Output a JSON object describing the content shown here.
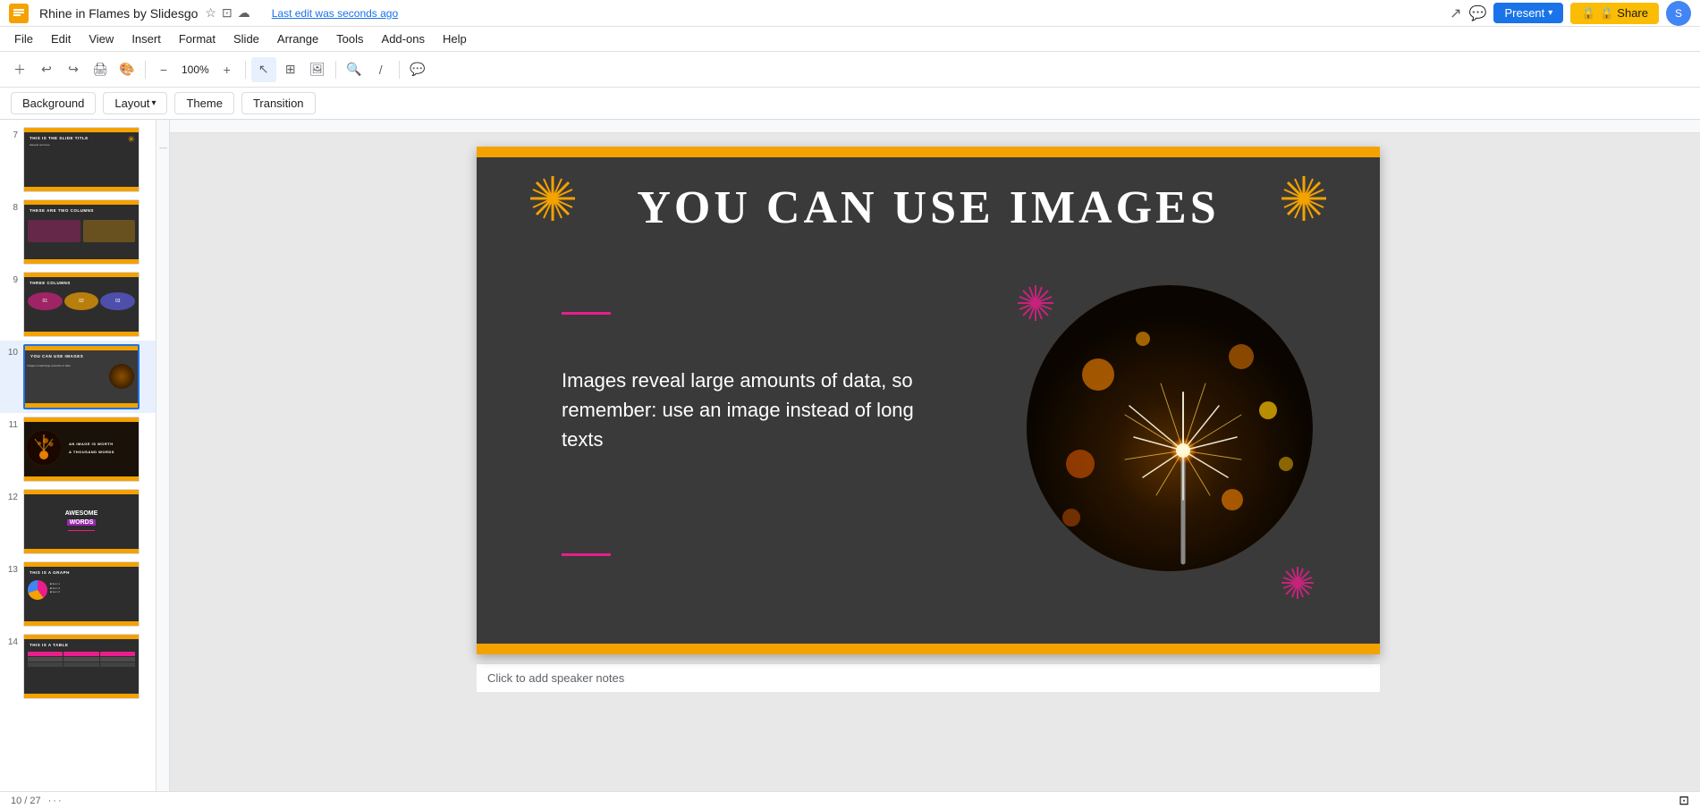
{
  "app": {
    "title": "Rhine in Flames by Slidesgo",
    "icon": "🟡",
    "edit_status": "Last edit was seconds ago"
  },
  "header": {
    "present_label": "Present",
    "share_label": "🔒 Share",
    "avatar_text": "S"
  },
  "menu": {
    "items": [
      "File",
      "Edit",
      "View",
      "Insert",
      "Format",
      "Slide",
      "Arrange",
      "Tools",
      "Add-ons",
      "Help"
    ]
  },
  "format_toolbar": {
    "background_label": "Background",
    "layout_label": "Layout",
    "theme_label": "Theme",
    "transition_label": "Transition"
  },
  "slides": [
    {
      "num": "7",
      "title": "THIS IS THE SLIDE TITLE",
      "type": "title"
    },
    {
      "num": "8",
      "title": "THESE ARE TWO COLUMNS",
      "type": "two-col"
    },
    {
      "num": "9",
      "title": "THREE COLUMNS",
      "type": "three-col"
    },
    {
      "num": "10",
      "title": "YOU CAN USE IMAGES",
      "type": "image",
      "active": true
    },
    {
      "num": "11",
      "title": "AN IMAGE IS WORTH A THOUSAND WORDS",
      "type": "sparkler"
    },
    {
      "num": "12",
      "title": "AWESOME WORDS",
      "type": "words"
    },
    {
      "num": "13",
      "title": "THIS IS A GRAPH",
      "type": "graph"
    },
    {
      "num": "14",
      "title": "THIS IS A TABLE",
      "type": "table"
    }
  ],
  "current_slide": {
    "title": "YOU CAN USE IMAGES",
    "body_text": "Images reveal large amounts of data, so remember: use an image instead of long texts",
    "decorations": {
      "star_left": "✳",
      "star_right": "✳",
      "starburst_color": "#e91e8c",
      "accent_color": "#f4a200"
    }
  },
  "speaker_notes": {
    "placeholder": "Click to add speaker notes"
  },
  "bottom_bar": {
    "slide_indicator": "10 / 27",
    "dots": "···"
  }
}
